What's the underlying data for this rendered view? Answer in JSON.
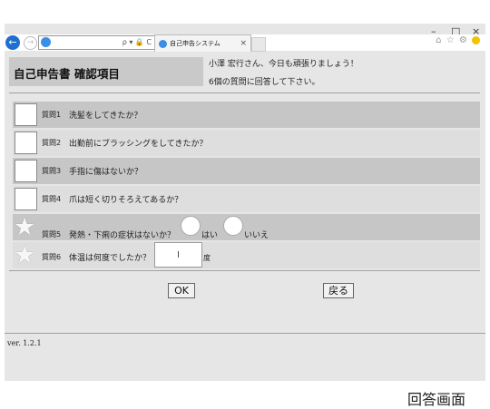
{
  "browser": {
    "tab_title": "自己申告システム",
    "tab_close": "×",
    "address_tools": "ρ ▾ 🔒 C",
    "window_controls": {
      "minimize": "–",
      "maximize": "□",
      "close": "×"
    },
    "right_tools": "⌂ ☆ ⚙"
  },
  "page": {
    "title": "自己申告書 確認項目",
    "greeting": "小澤 宏行さん、今日も頑張りましょう！",
    "instruction": "6個の質問に回答して下さい。",
    "questions": [
      {
        "label": "質問1",
        "text": "洗髪をしてきたか？"
      },
      {
        "label": "質問2",
        "text": "出勤前にブラッシングをしてきたか？"
      },
      {
        "label": "質問3",
        "text": "手指に傷はないか？"
      },
      {
        "label": "質問4",
        "text": "爪は短く切りそろえてあるか？"
      },
      {
        "label": "質問5",
        "text": "発熱・下痢の症状はないか？",
        "yes": "はい",
        "no": "いいえ"
      },
      {
        "label": "質問6",
        "text": "体温は何度でしたか？",
        "unit": "度"
      }
    ],
    "ok_button": "OK",
    "back_button": "戻る",
    "version": "ver. 1.2.1"
  },
  "caption": "回答画面"
}
